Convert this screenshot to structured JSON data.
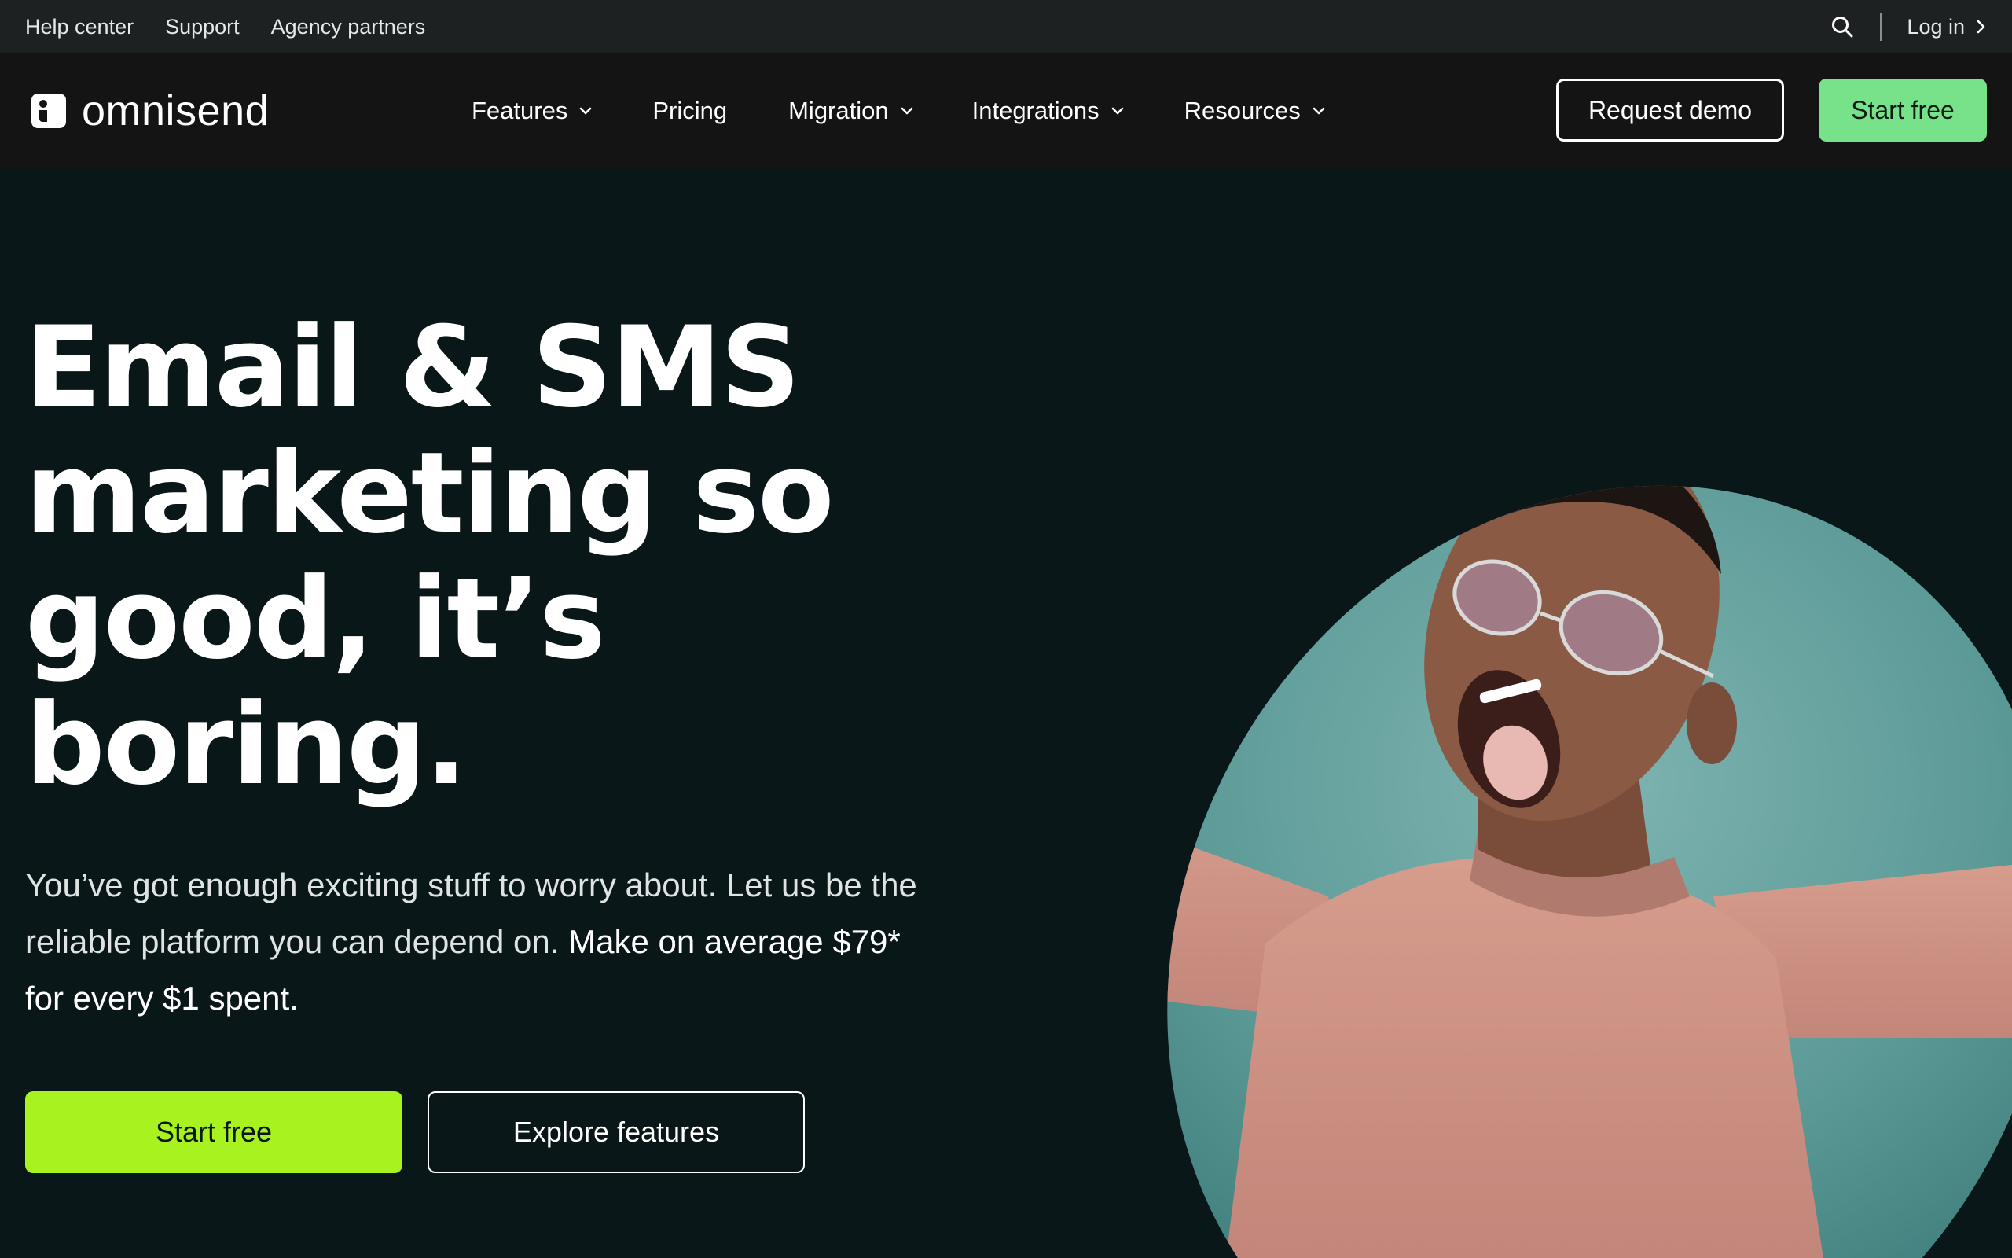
{
  "utility_bar": {
    "links": [
      "Help center",
      "Support",
      "Agency partners"
    ],
    "login_label": "Log in"
  },
  "nav": {
    "logo_text": "omnisend",
    "items": [
      {
        "label": "Features",
        "has_dropdown": true
      },
      {
        "label": "Pricing",
        "has_dropdown": false
      },
      {
        "label": "Migration",
        "has_dropdown": true
      },
      {
        "label": "Integrations",
        "has_dropdown": true
      },
      {
        "label": "Resources",
        "has_dropdown": true
      }
    ],
    "request_demo_label": "Request demo",
    "start_free_label": "Start free"
  },
  "hero": {
    "title_lines": [
      "Email & SMS",
      "marketing so",
      "good, it’s",
      "boring."
    ],
    "subtitle_plain": "You’ve got enough exciting stuff to worry about. Let us be the reliable platform you can depend on.",
    "subtitle_strong": "Make on average $79* for every $1 spent.",
    "primary_cta": "Start free",
    "secondary_cta": "Explore features"
  },
  "colors": {
    "page_background": "#0a1719",
    "utility_bar": "#1e2122",
    "nav_background": "#141414",
    "nav_cta_green": "#78e28a",
    "hero_cta_lime": "#a8f21f",
    "photo_backdrop_teal": "#5d9b98",
    "sweater_salmon": "#cf9383"
  },
  "icons": [
    "search-icon",
    "chevron-right-icon",
    "chevron-down-icon",
    "omnisend-logo-icon"
  ]
}
